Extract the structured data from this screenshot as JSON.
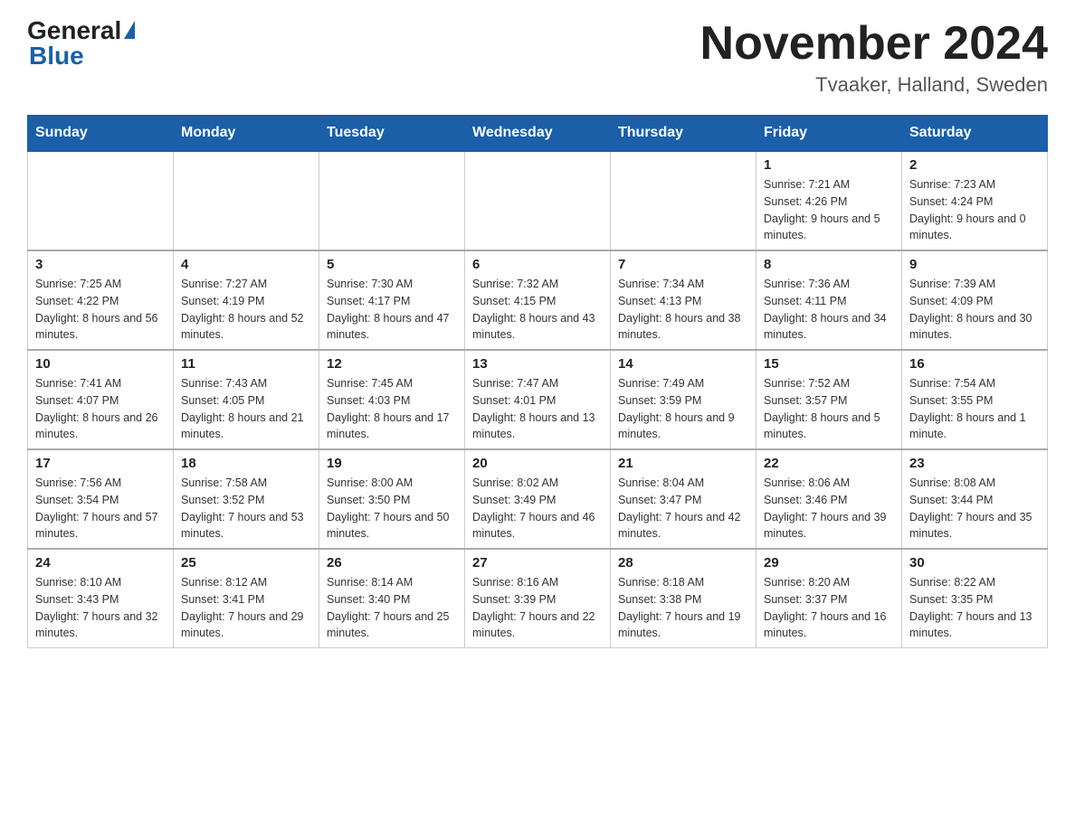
{
  "header": {
    "logo_general": "General",
    "logo_blue": "Blue",
    "month_title": "November 2024",
    "location": "Tvaaker, Halland, Sweden"
  },
  "weekdays": [
    "Sunday",
    "Monday",
    "Tuesday",
    "Wednesday",
    "Thursday",
    "Friday",
    "Saturday"
  ],
  "weeks": [
    [
      {
        "day": "",
        "info": ""
      },
      {
        "day": "",
        "info": ""
      },
      {
        "day": "",
        "info": ""
      },
      {
        "day": "",
        "info": ""
      },
      {
        "day": "",
        "info": ""
      },
      {
        "day": "1",
        "info": "Sunrise: 7:21 AM\nSunset: 4:26 PM\nDaylight: 9 hours and 5 minutes."
      },
      {
        "day": "2",
        "info": "Sunrise: 7:23 AM\nSunset: 4:24 PM\nDaylight: 9 hours and 0 minutes."
      }
    ],
    [
      {
        "day": "3",
        "info": "Sunrise: 7:25 AM\nSunset: 4:22 PM\nDaylight: 8 hours and 56 minutes."
      },
      {
        "day": "4",
        "info": "Sunrise: 7:27 AM\nSunset: 4:19 PM\nDaylight: 8 hours and 52 minutes."
      },
      {
        "day": "5",
        "info": "Sunrise: 7:30 AM\nSunset: 4:17 PM\nDaylight: 8 hours and 47 minutes."
      },
      {
        "day": "6",
        "info": "Sunrise: 7:32 AM\nSunset: 4:15 PM\nDaylight: 8 hours and 43 minutes."
      },
      {
        "day": "7",
        "info": "Sunrise: 7:34 AM\nSunset: 4:13 PM\nDaylight: 8 hours and 38 minutes."
      },
      {
        "day": "8",
        "info": "Sunrise: 7:36 AM\nSunset: 4:11 PM\nDaylight: 8 hours and 34 minutes."
      },
      {
        "day": "9",
        "info": "Sunrise: 7:39 AM\nSunset: 4:09 PM\nDaylight: 8 hours and 30 minutes."
      }
    ],
    [
      {
        "day": "10",
        "info": "Sunrise: 7:41 AM\nSunset: 4:07 PM\nDaylight: 8 hours and 26 minutes."
      },
      {
        "day": "11",
        "info": "Sunrise: 7:43 AM\nSunset: 4:05 PM\nDaylight: 8 hours and 21 minutes."
      },
      {
        "day": "12",
        "info": "Sunrise: 7:45 AM\nSunset: 4:03 PM\nDaylight: 8 hours and 17 minutes."
      },
      {
        "day": "13",
        "info": "Sunrise: 7:47 AM\nSunset: 4:01 PM\nDaylight: 8 hours and 13 minutes."
      },
      {
        "day": "14",
        "info": "Sunrise: 7:49 AM\nSunset: 3:59 PM\nDaylight: 8 hours and 9 minutes."
      },
      {
        "day": "15",
        "info": "Sunrise: 7:52 AM\nSunset: 3:57 PM\nDaylight: 8 hours and 5 minutes."
      },
      {
        "day": "16",
        "info": "Sunrise: 7:54 AM\nSunset: 3:55 PM\nDaylight: 8 hours and 1 minute."
      }
    ],
    [
      {
        "day": "17",
        "info": "Sunrise: 7:56 AM\nSunset: 3:54 PM\nDaylight: 7 hours and 57 minutes."
      },
      {
        "day": "18",
        "info": "Sunrise: 7:58 AM\nSunset: 3:52 PM\nDaylight: 7 hours and 53 minutes."
      },
      {
        "day": "19",
        "info": "Sunrise: 8:00 AM\nSunset: 3:50 PM\nDaylight: 7 hours and 50 minutes."
      },
      {
        "day": "20",
        "info": "Sunrise: 8:02 AM\nSunset: 3:49 PM\nDaylight: 7 hours and 46 minutes."
      },
      {
        "day": "21",
        "info": "Sunrise: 8:04 AM\nSunset: 3:47 PM\nDaylight: 7 hours and 42 minutes."
      },
      {
        "day": "22",
        "info": "Sunrise: 8:06 AM\nSunset: 3:46 PM\nDaylight: 7 hours and 39 minutes."
      },
      {
        "day": "23",
        "info": "Sunrise: 8:08 AM\nSunset: 3:44 PM\nDaylight: 7 hours and 35 minutes."
      }
    ],
    [
      {
        "day": "24",
        "info": "Sunrise: 8:10 AM\nSunset: 3:43 PM\nDaylight: 7 hours and 32 minutes."
      },
      {
        "day": "25",
        "info": "Sunrise: 8:12 AM\nSunset: 3:41 PM\nDaylight: 7 hours and 29 minutes."
      },
      {
        "day": "26",
        "info": "Sunrise: 8:14 AM\nSunset: 3:40 PM\nDaylight: 7 hours and 25 minutes."
      },
      {
        "day": "27",
        "info": "Sunrise: 8:16 AM\nSunset: 3:39 PM\nDaylight: 7 hours and 22 minutes."
      },
      {
        "day": "28",
        "info": "Sunrise: 8:18 AM\nSunset: 3:38 PM\nDaylight: 7 hours and 19 minutes."
      },
      {
        "day": "29",
        "info": "Sunrise: 8:20 AM\nSunset: 3:37 PM\nDaylight: 7 hours and 16 minutes."
      },
      {
        "day": "30",
        "info": "Sunrise: 8:22 AM\nSunset: 3:35 PM\nDaylight: 7 hours and 13 minutes."
      }
    ]
  ]
}
